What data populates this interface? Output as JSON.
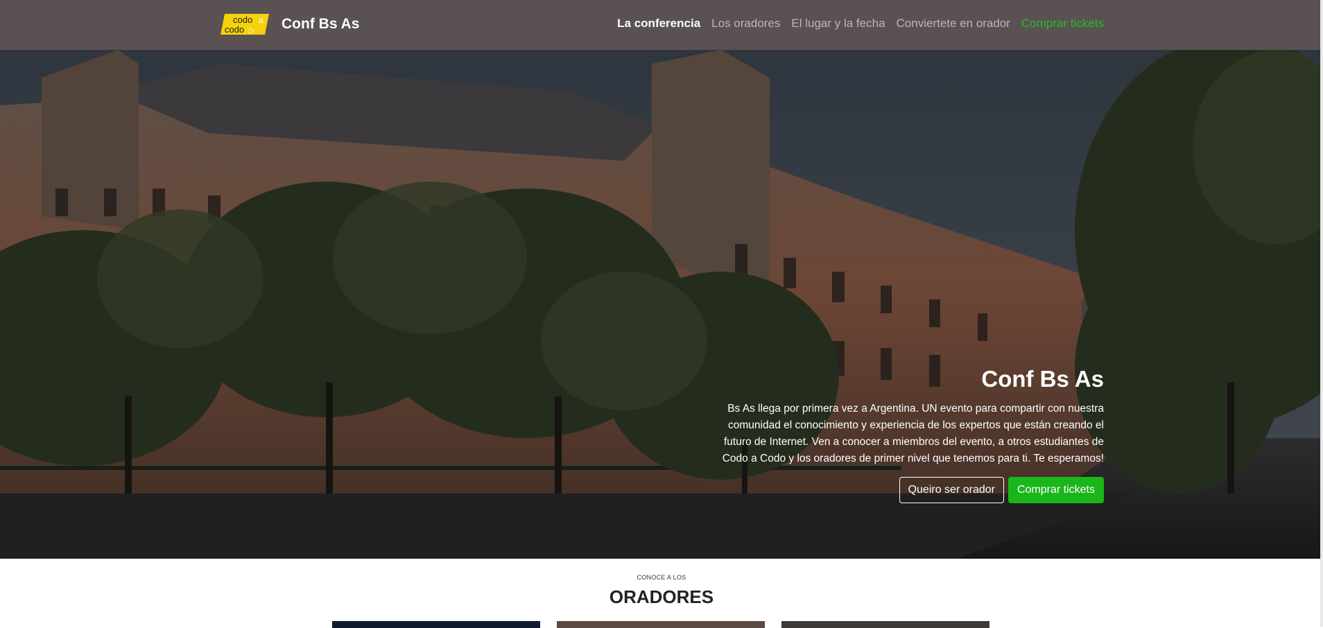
{
  "brand": {
    "logo_line1": "codo",
    "logo_line2": "codo",
    "logo_mark1": "a",
    "logo_mark2": "▷",
    "name": "Conf Bs As"
  },
  "nav": {
    "items": [
      {
        "label": "La conferencia",
        "state": "active"
      },
      {
        "label": "Los oradores",
        "state": "default"
      },
      {
        "label": "El lugar y la fecha",
        "state": "default"
      },
      {
        "label": "Conviertete en orador",
        "state": "default"
      },
      {
        "label": "Comprar tickets",
        "state": "highlight"
      }
    ]
  },
  "hero": {
    "title": "Conf Bs As",
    "text": "Bs As llega por primera vez a Argentina. UN evento para compartir con nuestra comunidad el conocimiento y experiencia de los expertos que están creando el futuro de Internet. Ven a conocer a miembros del evento, a otros estudiantes de Codo a Codo y los oradores de primer nivel que tenemos para ti. Te esperamos!",
    "button_outline": "Queiro ser orador",
    "button_primary": "Comprar tickets"
  },
  "speakers": {
    "caption": "CONOCE A LOS",
    "title": "ORADORES"
  },
  "colors": {
    "navbar": "#5a5152",
    "accent_green": "#19b619",
    "logo_yellow": "#f5d20a"
  }
}
